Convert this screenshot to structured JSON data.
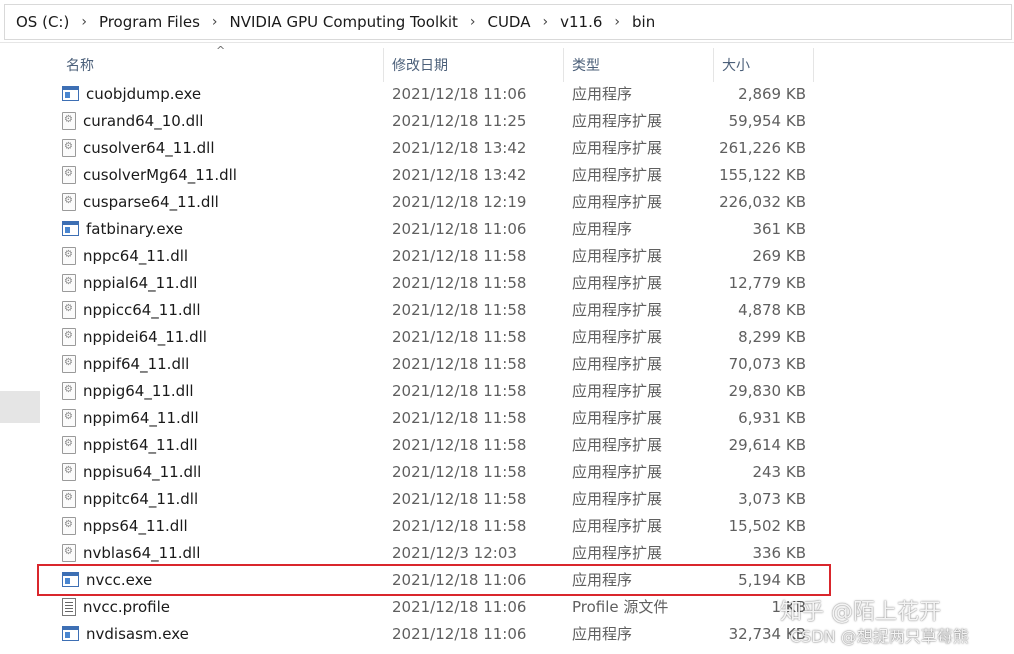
{
  "breadcrumb": [
    "OS (C:)",
    "Program Files",
    "NVIDIA GPU Computing Toolkit",
    "CUDA",
    "v11.6",
    "bin"
  ],
  "breadcrumb_separator": "›",
  "columns": {
    "name": "名称",
    "date": "修改日期",
    "type": "类型",
    "size": "大小",
    "sort_indicator": "^"
  },
  "files": [
    {
      "name": "cuobjdump.exe",
      "date": "2021/12/18 11:06",
      "type": "应用程序",
      "size": "2,869 KB",
      "icon": "exe-icon"
    },
    {
      "name": "curand64_10.dll",
      "date": "2021/12/18 11:25",
      "type": "应用程序扩展",
      "size": "59,954 KB",
      "icon": "dll-icon"
    },
    {
      "name": "cusolver64_11.dll",
      "date": "2021/12/18 13:42",
      "type": "应用程序扩展",
      "size": "261,226 KB",
      "icon": "dll-icon"
    },
    {
      "name": "cusolverMg64_11.dll",
      "date": "2021/12/18 13:42",
      "type": "应用程序扩展",
      "size": "155,122 KB",
      "icon": "dll-icon"
    },
    {
      "name": "cusparse64_11.dll",
      "date": "2021/12/18 12:19",
      "type": "应用程序扩展",
      "size": "226,032 KB",
      "icon": "dll-icon"
    },
    {
      "name": "fatbinary.exe",
      "date": "2021/12/18 11:06",
      "type": "应用程序",
      "size": "361 KB",
      "icon": "exe-icon"
    },
    {
      "name": "nppc64_11.dll",
      "date": "2021/12/18 11:58",
      "type": "应用程序扩展",
      "size": "269 KB",
      "icon": "dll-icon"
    },
    {
      "name": "nppial64_11.dll",
      "date": "2021/12/18 11:58",
      "type": "应用程序扩展",
      "size": "12,779 KB",
      "icon": "dll-icon"
    },
    {
      "name": "nppicc64_11.dll",
      "date": "2021/12/18 11:58",
      "type": "应用程序扩展",
      "size": "4,878 KB",
      "icon": "dll-icon"
    },
    {
      "name": "nppidei64_11.dll",
      "date": "2021/12/18 11:58",
      "type": "应用程序扩展",
      "size": "8,299 KB",
      "icon": "dll-icon"
    },
    {
      "name": "nppif64_11.dll",
      "date": "2021/12/18 11:58",
      "type": "应用程序扩展",
      "size": "70,073 KB",
      "icon": "dll-icon"
    },
    {
      "name": "nppig64_11.dll",
      "date": "2021/12/18 11:58",
      "type": "应用程序扩展",
      "size": "29,830 KB",
      "icon": "dll-icon"
    },
    {
      "name": "nppim64_11.dll",
      "date": "2021/12/18 11:58",
      "type": "应用程序扩展",
      "size": "6,931 KB",
      "icon": "dll-icon"
    },
    {
      "name": "nppist64_11.dll",
      "date": "2021/12/18 11:58",
      "type": "应用程序扩展",
      "size": "29,614 KB",
      "icon": "dll-icon"
    },
    {
      "name": "nppisu64_11.dll",
      "date": "2021/12/18 11:58",
      "type": "应用程序扩展",
      "size": "243 KB",
      "icon": "dll-icon"
    },
    {
      "name": "nppitc64_11.dll",
      "date": "2021/12/18 11:58",
      "type": "应用程序扩展",
      "size": "3,073 KB",
      "icon": "dll-icon"
    },
    {
      "name": "npps64_11.dll",
      "date": "2021/12/18 11:58",
      "type": "应用程序扩展",
      "size": "15,502 KB",
      "icon": "dll-icon"
    },
    {
      "name": "nvblas64_11.dll",
      "date": "2021/12/3 12:03",
      "type": "应用程序扩展",
      "size": "336 KB",
      "icon": "dll-icon"
    },
    {
      "name": "nvcc.exe",
      "date": "2021/12/18 11:06",
      "type": "应用程序",
      "size": "5,194 KB",
      "icon": "exe-icon",
      "highlighted": true
    },
    {
      "name": "nvcc.profile",
      "date": "2021/12/18 11:06",
      "type": "Profile 源文件",
      "size": "1 KB",
      "icon": "text-file-icon"
    },
    {
      "name": "nvdisasm.exe",
      "date": "2021/12/18 11:06",
      "type": "应用程序",
      "size": "32,734 KB",
      "icon": "exe-icon"
    }
  ],
  "highlight_color": "#d9262c",
  "watermark": {
    "zhihu": "知乎 @陌上花开",
    "csdn": "CSDN @想捉两只草莓熊"
  }
}
